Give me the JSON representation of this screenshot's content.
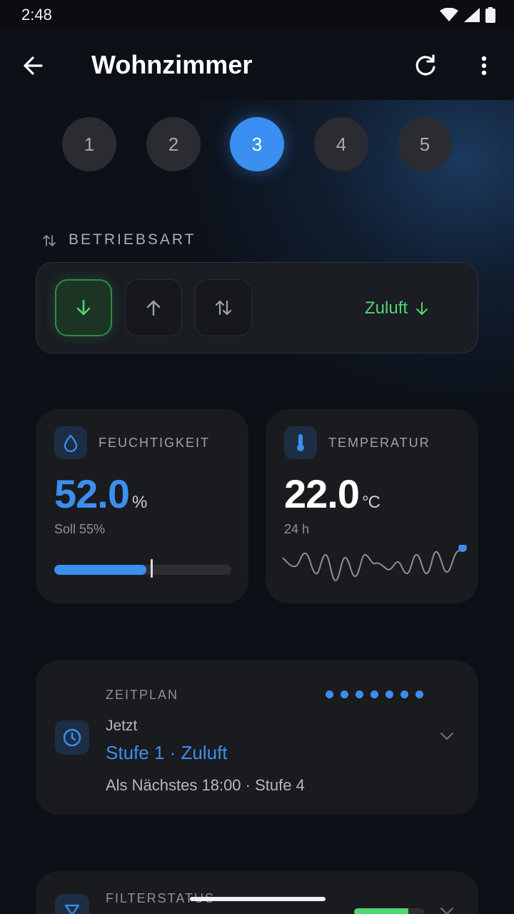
{
  "status": {
    "time": "2:48"
  },
  "appbar": {
    "title": "Wohnzimmer"
  },
  "steps": [
    "1",
    "2",
    "3",
    "4",
    "5"
  ],
  "active_step": "3",
  "mode": {
    "label": "BETRIEBSART",
    "status": "Zuluft",
    "active_index": 0
  },
  "humidity": {
    "label": "FEUCHTIGKEIT",
    "value": "52.0",
    "unit": "%",
    "target": "Soll 55%",
    "fill_percent": 52,
    "target_percent": 55
  },
  "temperature": {
    "label": "TEMPERATUR",
    "value": "22.0",
    "unit": "°C",
    "range": "24 h"
  },
  "schedule": {
    "label": "ZEITPLAN",
    "now_label": "Jetzt",
    "now_value": "Stufe 1 · Zuluft",
    "next": "Als Nächstes 18:00 · Stufe 4",
    "dot_count": 7
  },
  "filter": {
    "label": "FILTERSTATUS"
  },
  "colors": {
    "accent": "#3b8ff0",
    "green": "#4fd670",
    "card": "#1a1b1e",
    "background": "#0c1017"
  }
}
